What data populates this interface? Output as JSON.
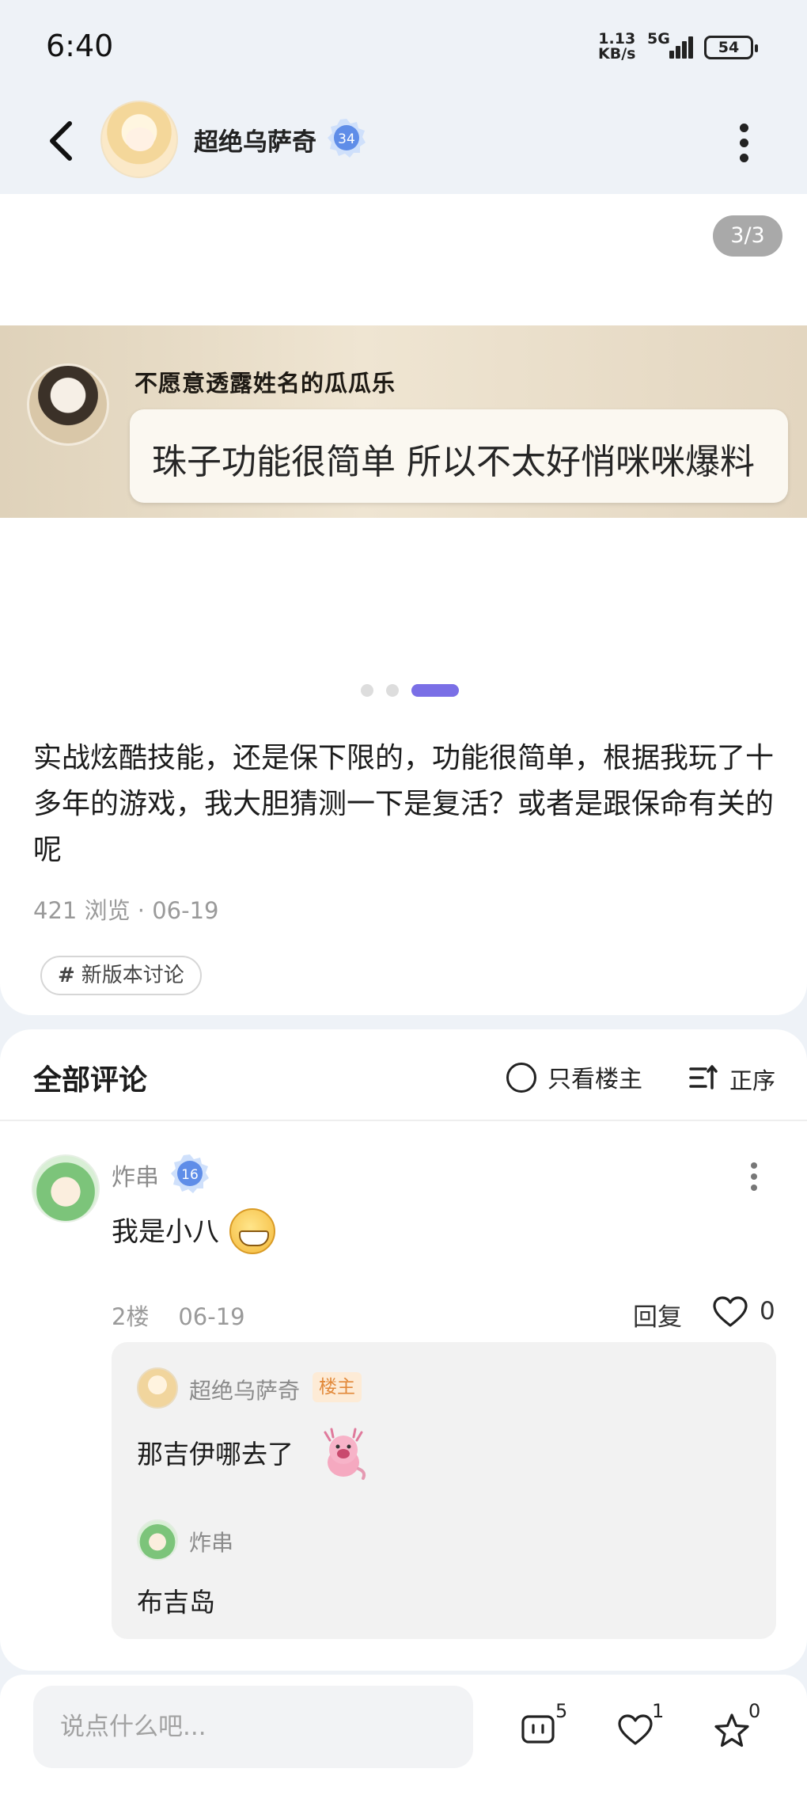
{
  "status_bar": {
    "time": "6:40",
    "net_speed_top": "1.13",
    "net_speed_bottom": "KB/s",
    "network": "5G",
    "battery": "54"
  },
  "header": {
    "author_name": "超绝乌萨奇",
    "author_level": "34",
    "back_icon": "chevron-left-icon",
    "more_icon": "more-vertical-icon"
  },
  "post": {
    "image_counter": "3/3",
    "image": {
      "speaker_name": "不愿意透露姓名的瓜瓜乐",
      "bubble_text": "珠子功能很简单 所以不太好悄咪咪爆料"
    },
    "carousel": {
      "total": 3,
      "active": 3
    },
    "text": "实战炫酷技能，还是保下限的，功能很简单，根据我玩了十多年的游戏，我大胆猜测一下是复活？或者是跟保命有关的呢",
    "meta": "421 浏览 · 06-19",
    "tag": "新版本讨论"
  },
  "comments": {
    "title": "全部评论",
    "only_owner_label": "只看楼主",
    "sort_label": "正序",
    "items": [
      {
        "user": "炸串",
        "level": "16",
        "text": "我是小八",
        "floor": "2楼",
        "date": "06-19",
        "reply_label": "回复",
        "likes": "0",
        "replies": [
          {
            "user": "超绝乌萨奇",
            "badge": "楼主",
            "text": "那吉伊哪去了"
          },
          {
            "user": "炸串",
            "text": "布吉岛"
          }
        ]
      }
    ]
  },
  "bottom_bar": {
    "input_placeholder": "说点什么吧...",
    "comment_count": "5",
    "like_count": "1",
    "favorite_count": "0"
  },
  "colors": {
    "accent": "#7a6fe6",
    "owner_badge_bg": "#fdebd6",
    "owner_badge_text": "#e2893a",
    "page_bg": "#eef2f7"
  }
}
